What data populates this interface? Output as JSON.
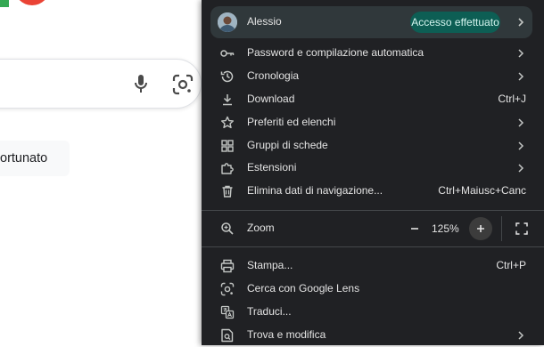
{
  "page": {
    "lucky_button": "ortunato"
  },
  "menu": {
    "profile": {
      "name": "Alessio",
      "status": "Accesso effettuato"
    },
    "items_top": [
      {
        "icon": "key-icon",
        "label": "Password e compilazione automatica",
        "shortcut": "",
        "submenu": true
      },
      {
        "icon": "history-icon",
        "label": "Cronologia",
        "shortcut": "",
        "submenu": true
      },
      {
        "icon": "download-icon",
        "label": "Download",
        "shortcut": "Ctrl+J",
        "submenu": false
      },
      {
        "icon": "star-icon",
        "label": "Preferiti ed elenchi",
        "shortcut": "",
        "submenu": true
      },
      {
        "icon": "tab-groups-icon",
        "label": "Gruppi di schede",
        "shortcut": "",
        "submenu": true
      },
      {
        "icon": "extension-icon",
        "label": "Estensioni",
        "shortcut": "",
        "submenu": true
      },
      {
        "icon": "trash-icon",
        "label": "Elimina dati di navigazione...",
        "shortcut": "Ctrl+Maiusc+Canc",
        "submenu": false
      }
    ],
    "zoom": {
      "label": "Zoom",
      "value": "125%",
      "minus": "−",
      "plus": "+"
    },
    "items_bottom": [
      {
        "icon": "print-icon",
        "label": "Stampa...",
        "shortcut": "Ctrl+P",
        "submenu": false
      },
      {
        "icon": "google-lens-icon",
        "label": "Cerca con Google Lens",
        "shortcut": "",
        "submenu": false
      },
      {
        "icon": "translate-icon",
        "label": "Traduci...",
        "shortcut": "",
        "submenu": false
      },
      {
        "icon": "find-edit-icon",
        "label": "Trova e modifica",
        "shortcut": "",
        "submenu": true
      }
    ]
  },
  "colors": {
    "menu_bg": "#202124",
    "profile_bg": "#30383b",
    "badge_bg": "#0d5e54",
    "zoom_plus_bg": "#3c3c3c"
  }
}
